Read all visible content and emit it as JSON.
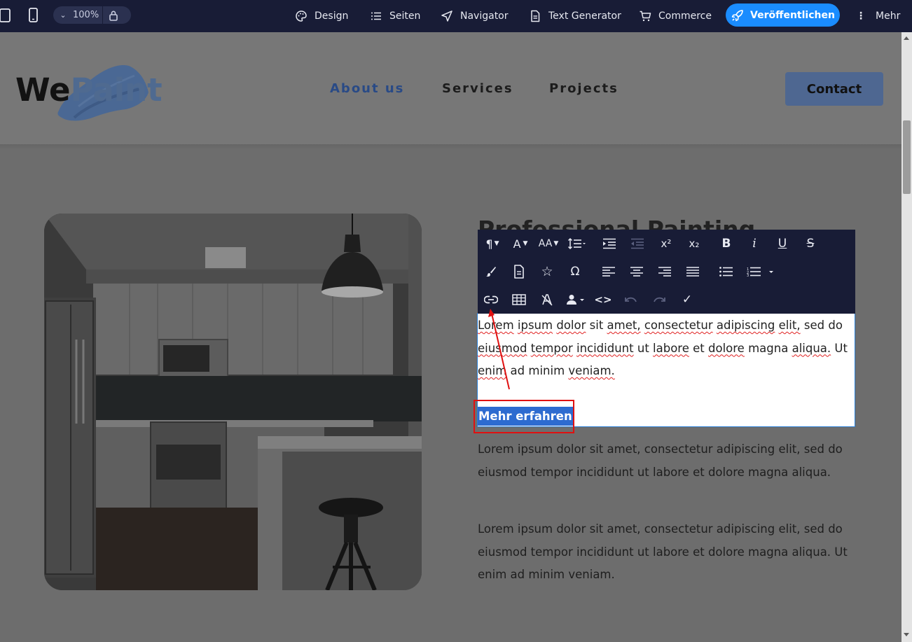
{
  "editor": {
    "zoom_level": "100%",
    "nav": {
      "design": "Design",
      "pages": "Seiten",
      "navigator": "Navigator",
      "text_generator": "Text Generator",
      "commerce": "Commerce"
    },
    "publish_label": "Veröffentlichen",
    "more_label": "Mehr",
    "accent_color": "#1a8cff"
  },
  "site": {
    "logo": {
      "part1": "We",
      "part2": "Paint"
    },
    "nav": {
      "about": "About us",
      "services": "Services",
      "projects": "Projects"
    },
    "contact_label": "Contact",
    "heading_partial": "Professional Painting",
    "edit_paragraph": {
      "w1": "Lorem",
      "w2": "ipsum",
      "w3": "dolor",
      "w4": "sit",
      "w5": "amet,",
      "w6": "consectetur",
      "w7": "adipiscing",
      "w8": "elit,",
      "w9": "sed",
      "w10": "do",
      "w11": "eiusmod",
      "w12": "tempor",
      "w13": "incididunt",
      "w14": "ut",
      "w15": "labore",
      "w16": "et",
      "w17": "dolore",
      "w18": "magna",
      "w19": "aliqua.",
      "w20": "Ut",
      "w21": "enim",
      "w22": "ad",
      "w23": "minim",
      "w24": "veniam."
    },
    "selected_link_text": "Mehr erfahren",
    "paragraph2": "Lorem ipsum dolor sit amet, consectetur adipiscing elit, sed do eiusmod tempor incididunt ut labore et dolore magna aliqua.",
    "paragraph3": "Lorem ipsum dolor sit amet, consectetur adipiscing elit, sed do eiusmod tempor incididunt ut labore et dolore magna aliqua. Ut enim ad minim veniam."
  },
  "toolbar_icons": [
    "paragraph-format-icon",
    "font-family-icon",
    "font-size-icon",
    "line-height-icon",
    "indent-icon",
    "outdent-icon",
    "superscript-icon",
    "subscript-icon",
    "bold-icon",
    "italic-icon",
    "underline-icon",
    "strikethrough-icon",
    "paint-brush-icon",
    "document-icon",
    "star-icon",
    "omega-icon",
    "align-left-icon",
    "align-center-icon",
    "align-right-icon",
    "align-justify-icon",
    "bullet-list-icon",
    "numbered-list-icon",
    "insert-link-icon",
    "table-icon",
    "clear-formatting-icon",
    "person-icon",
    "code-view-icon",
    "undo-icon",
    "redo-icon",
    "check-icon"
  ],
  "toolbar_glyphs": {
    "paragraph": "¶",
    "font": "A",
    "size": "AA",
    "sup": "x²",
    "sub": "x₂",
    "bold": "B",
    "italic": "i",
    "underline": "U",
    "strike": "S",
    "omega": "Ω",
    "star": "☆",
    "code": "<>",
    "check": "✓"
  }
}
